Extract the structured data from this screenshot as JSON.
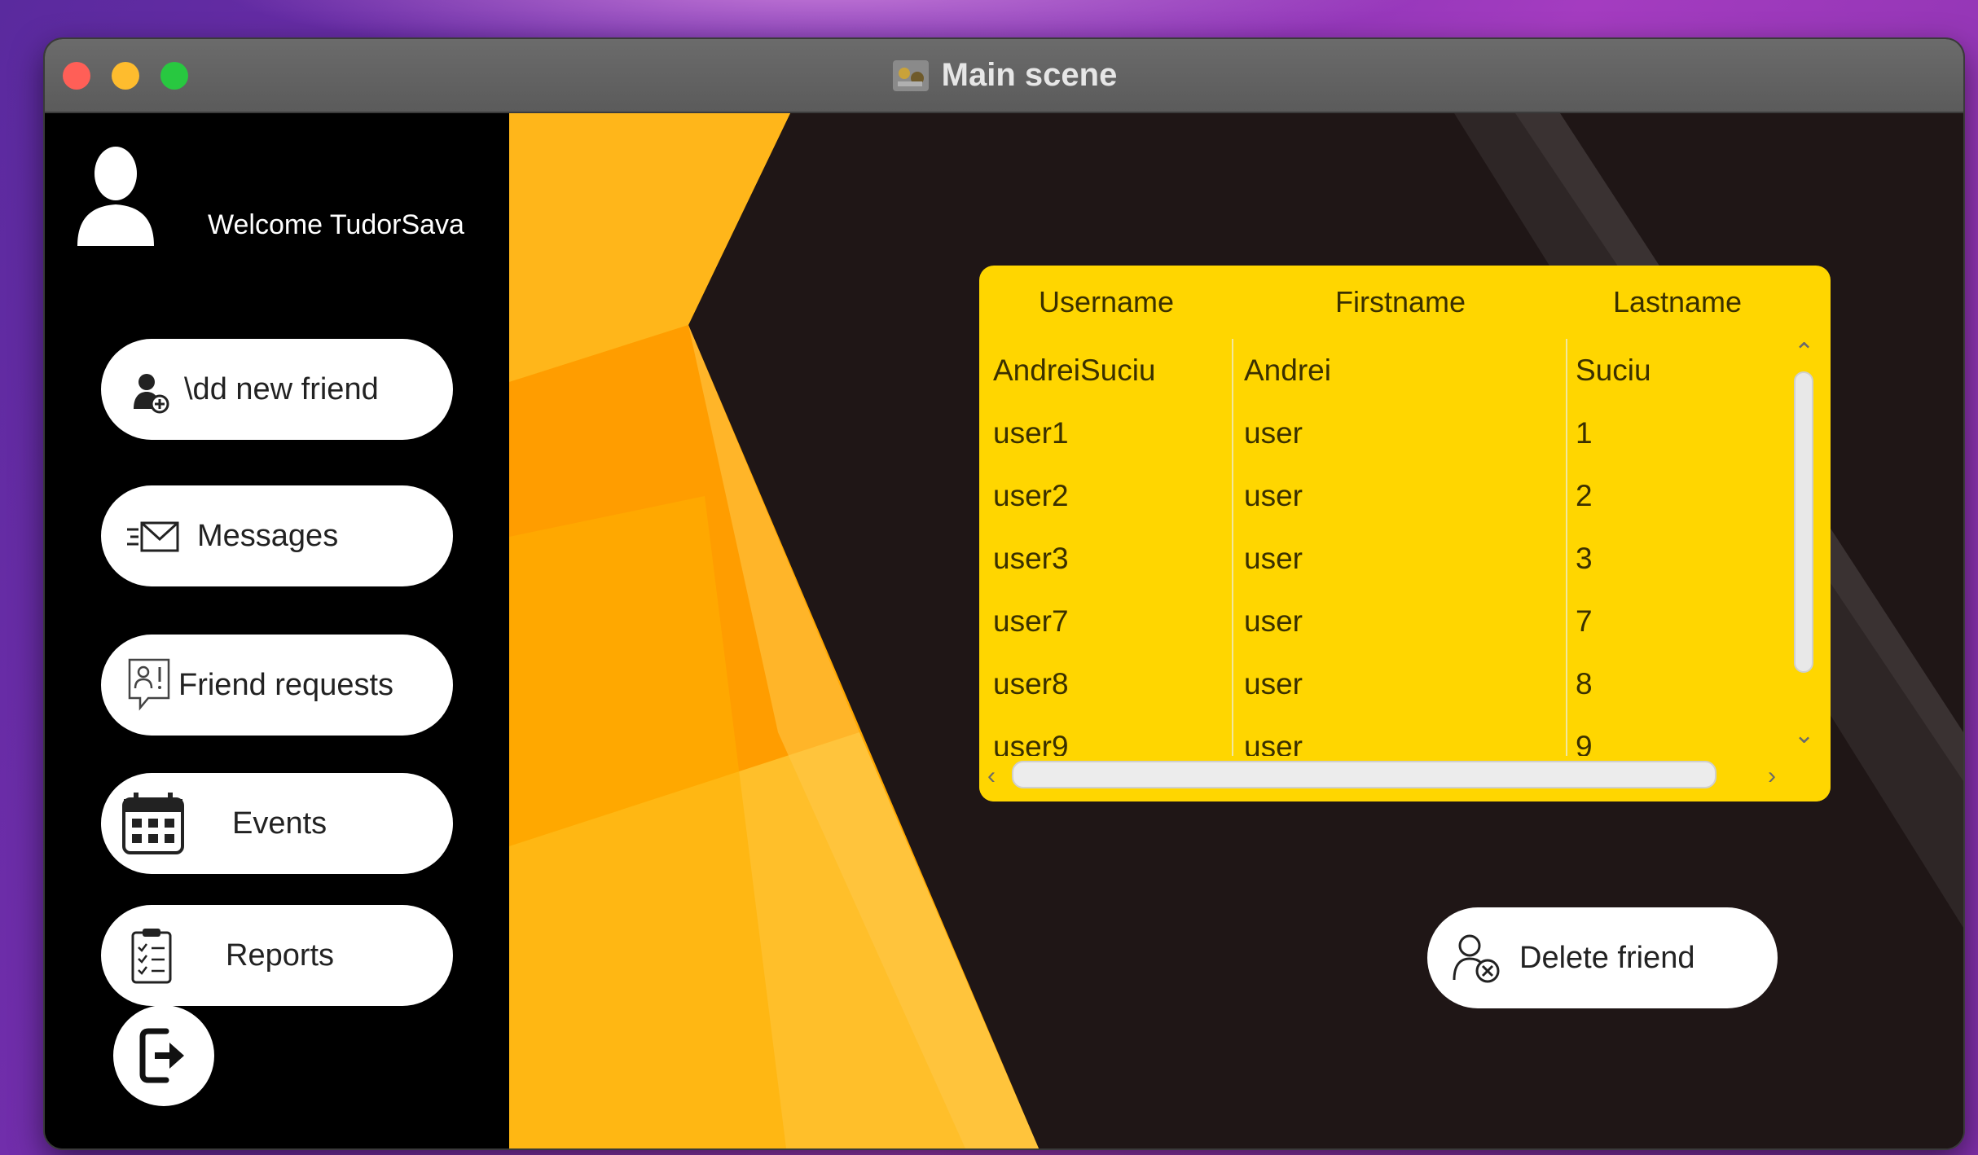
{
  "window": {
    "title": "Main scene"
  },
  "sidebar": {
    "welcome": "Welcome TudorSava",
    "buttons": {
      "add_friend": "\\dd new friend",
      "messages": "Messages",
      "friend_requests": "Friend requests",
      "events": "Events",
      "reports": "Reports"
    }
  },
  "table": {
    "headers": [
      "Username",
      "Firstname",
      "Lastname"
    ],
    "rows": [
      [
        "AndreiSuciu",
        "Andrei",
        "Suciu"
      ],
      [
        "user1",
        "user",
        "1"
      ],
      [
        "user2",
        "user",
        "2"
      ],
      [
        "user3",
        "user",
        "3"
      ],
      [
        "user7",
        "user",
        "7"
      ],
      [
        "user8",
        "user",
        "8"
      ],
      [
        "user9",
        "user",
        "9"
      ]
    ]
  },
  "actions": {
    "delete_friend": "Delete friend"
  },
  "colors": {
    "table_bg": "#ffd600",
    "panel_bg": "#000000",
    "button_bg": "#ffffff",
    "accent_orange": "#ffb000"
  },
  "icons": {
    "avatar": "user-silhouette-icon",
    "add_friend": "add-user-icon",
    "messages": "envelope-icon",
    "friend_requests": "friend-request-icon",
    "events": "calendar-icon",
    "reports": "clipboard-icon",
    "logout": "logout-icon",
    "delete_friend": "remove-user-icon"
  }
}
